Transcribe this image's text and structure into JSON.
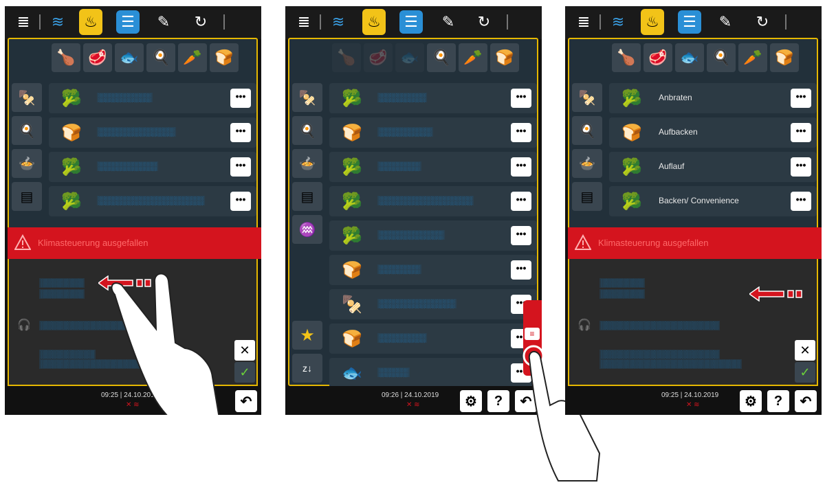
{
  "colors": {
    "accent": "#f2c318",
    "alert": "#d4141e",
    "panel": "#22303a"
  },
  "icons": {
    "menu": "hamburger-menu-icon",
    "cooking_paths": "cooking-paths-icon",
    "catalog": "catalog-icon",
    "programs": "programs-icon",
    "edit": "edit-icon",
    "ecocare": "ecocare-icon",
    "more": "more-options-icon",
    "settings": "settings-icon",
    "help": "help-icon",
    "back": "back-icon",
    "favorite": "favorite-star-icon",
    "sort": "sort-icon",
    "service": "service-tool-icon",
    "confirm": "check-icon",
    "warning": "warning-triangle-icon",
    "headset": "headset-icon",
    "swipe": "swipe-left-arrow-icon",
    "message": "message-icon"
  },
  "panel1": {
    "items": [
      {
        "label": ""
      },
      {
        "label": ""
      },
      {
        "label": ""
      },
      {
        "label": ""
      }
    ],
    "alert": "Klimasteuerung ausgefallen",
    "clock": "09:25 | 24.10.2019"
  },
  "panel2": {
    "items": [
      {
        "label": ""
      },
      {
        "label": ""
      },
      {
        "label": ""
      },
      {
        "label": ""
      },
      {
        "label": ""
      },
      {
        "label": ""
      },
      {
        "label": ""
      },
      {
        "label": ""
      },
      {
        "label": ""
      }
    ],
    "clock": "09:26 | 24.10.2019",
    "help": "?"
  },
  "panel3": {
    "items": [
      {
        "label": "Anbraten"
      },
      {
        "label": "Aufbacken"
      },
      {
        "label": "Auflauf"
      },
      {
        "label": "Backen/ Convenience"
      }
    ],
    "alert": "Klimasteuerung ausgefallen",
    "clock": "09:25 | 24.10.2019",
    "help": "?"
  }
}
